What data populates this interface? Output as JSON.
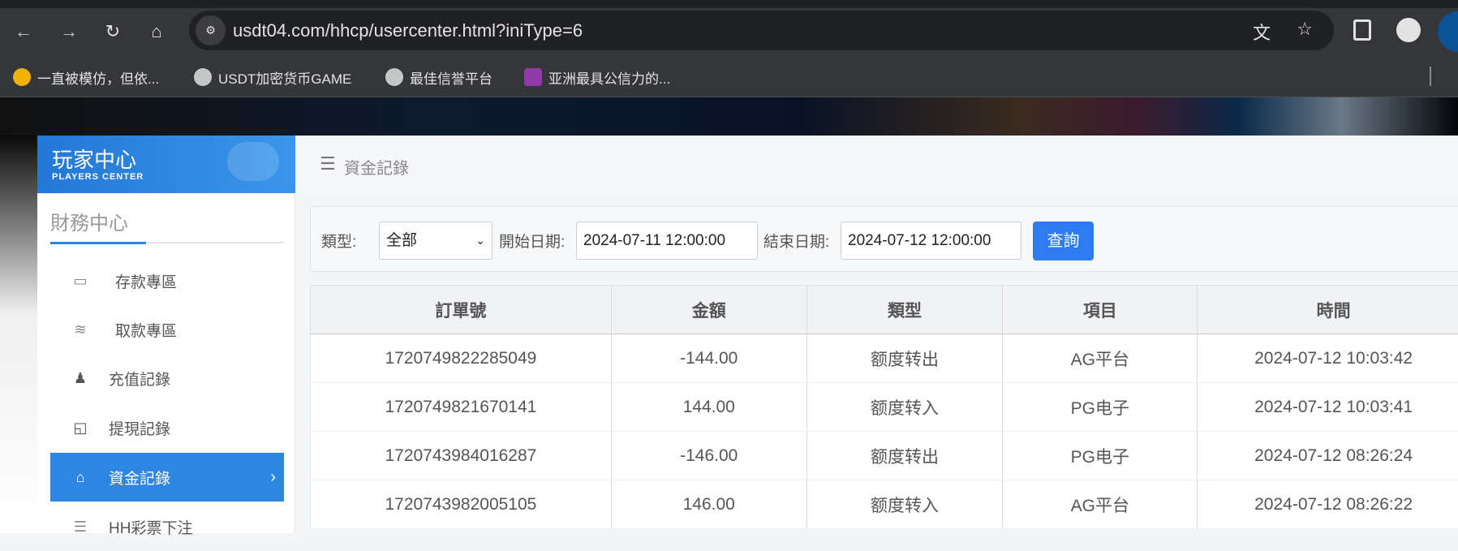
{
  "browser": {
    "url": "usdt04.com/hhcp/usercenter.html?iniType=6",
    "bookmarks": [
      {
        "label": "一直被模仿，但依...",
        "icon": "five-logo-icon"
      },
      {
        "label": "USDT加密货币GAME",
        "icon": "globe-icon"
      },
      {
        "label": "最佳信誉平台",
        "icon": "globe-icon"
      },
      {
        "label": "亚洲最具公信力的...",
        "icon": "flower-logo-icon"
      }
    ]
  },
  "sidebar": {
    "title": "玩家中心",
    "subtitle": "PLAYERS CENTER",
    "section": "財務中心",
    "items": [
      {
        "label": "存款專區",
        "icon": "card-icon"
      },
      {
        "label": "取款專區",
        "icon": "hand-cash-icon"
      },
      {
        "label": "充值記錄",
        "icon": "money-bag-icon"
      },
      {
        "label": "提現記錄",
        "icon": "wallet-icon"
      },
      {
        "label": "資金記錄",
        "icon": "house-money-icon",
        "active": true
      },
      {
        "label": "HH彩票下注",
        "icon": "list-icon"
      }
    ]
  },
  "main": {
    "title": "資金記錄",
    "filter": {
      "type_label": "類型:",
      "type_value": "全部",
      "start_label": "開始日期:",
      "start_value": "2024-07-11 12:00:00",
      "end_label": "結束日期:",
      "end_value": "2024-07-12 12:00:00",
      "query_label": "查詢"
    },
    "table": {
      "columns": [
        "訂單號",
        "金額",
        "類型",
        "項目",
        "時間"
      ],
      "rows": [
        [
          "1720749822285049",
          "-144.00",
          "额度转出",
          "AG平台",
          "2024-07-12 10:03:42"
        ],
        [
          "1720749821670141",
          "144.00",
          "额度转入",
          "PG电子",
          "2024-07-12 10:03:41"
        ],
        [
          "1720743984016287",
          "-146.00",
          "额度转出",
          "PG电子",
          "2024-07-12 08:26:24"
        ],
        [
          "1720743982005105",
          "146.00",
          "额度转入",
          "AG平台",
          "2024-07-12 08:26:22"
        ]
      ]
    }
  },
  "colors": {
    "accent": "#2d87e2",
    "button": "#2e7cf0"
  }
}
